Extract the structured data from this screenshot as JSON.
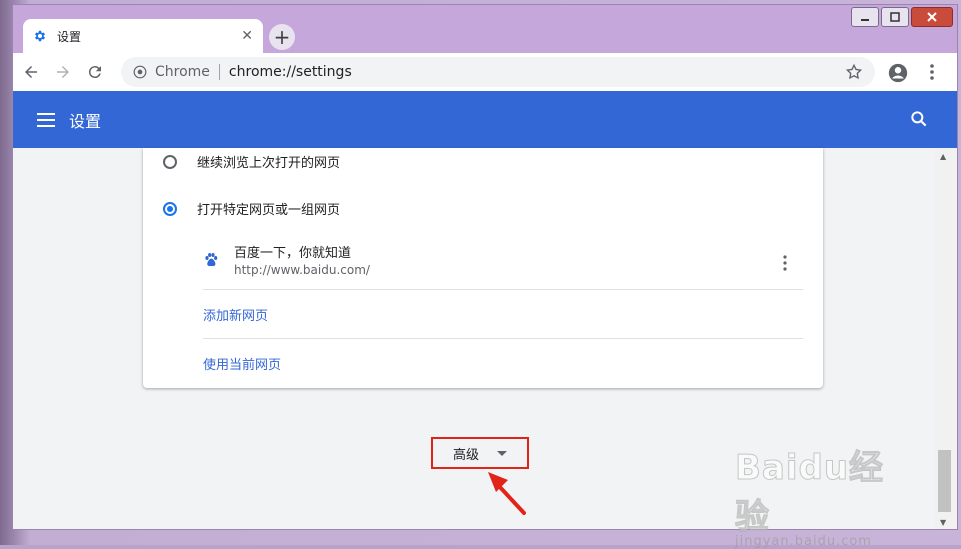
{
  "browser": {
    "tab_title": "设置",
    "omnibox_site": "Chrome",
    "omnibox_url": "chrome://settings"
  },
  "settings": {
    "header_title": "设置",
    "startup_options": [
      {
        "label": "继续浏览上次打开的网页",
        "checked": false
      },
      {
        "label": "打开特定网页或一组网页",
        "checked": true
      }
    ],
    "page_entry": {
      "title": "百度一下，你就知道",
      "url": "http://www.baidu.com/"
    },
    "add_page_link": "添加新网页",
    "use_current_link": "使用当前网页",
    "advanced_label": "高级"
  },
  "colors": {
    "header_blue": "#3367d6",
    "link_blue": "#3367d6",
    "radio_blue": "#1a73e8",
    "annotation_red": "#e2231a"
  },
  "icons": {
    "tab": "gear-icon",
    "back": "back-arrow-icon",
    "forward": "forward-arrow-icon",
    "reload": "reload-icon",
    "bookmark": "star-icon",
    "account": "account-icon",
    "menu": "kebab-menu-icon",
    "hamburger": "hamburger-icon",
    "search": "search-icon",
    "page": "baidu-paw-icon"
  },
  "watermark": {
    "main": "Baidu经验",
    "sub": "jingyan.baidu.com"
  }
}
